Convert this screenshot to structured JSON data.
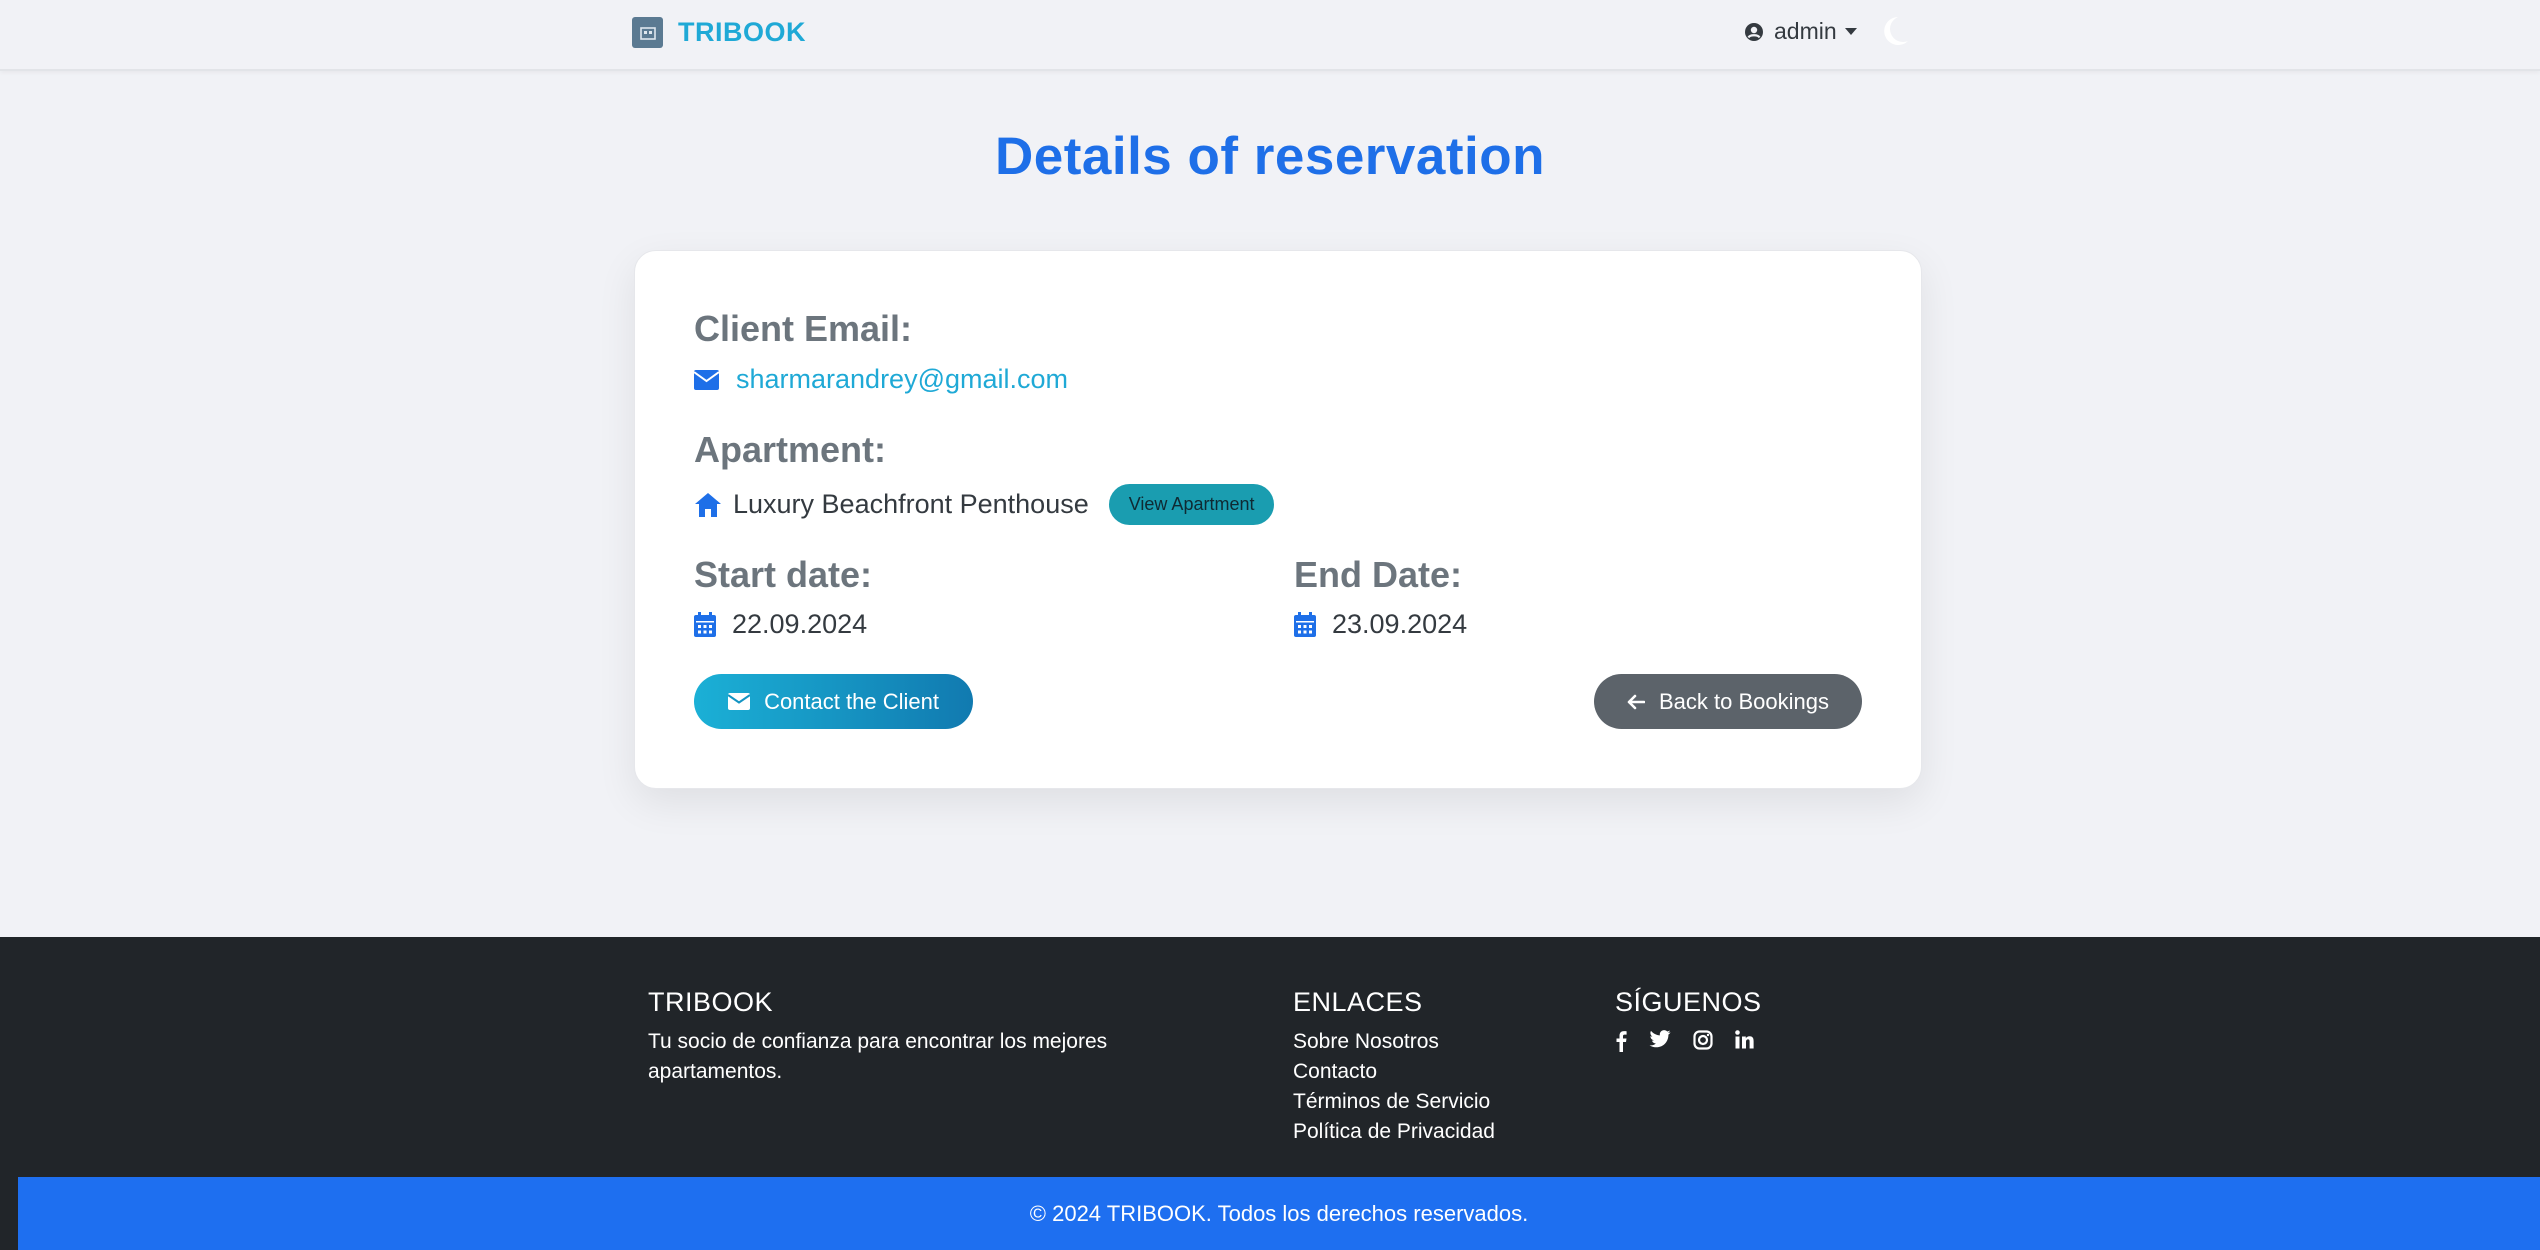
{
  "navbar": {
    "brand": "TRIBOOK",
    "user": "admin",
    "icons": {
      "logo": "hotel-logo-icon",
      "user": "user-circle-icon",
      "theme": "moon-icon"
    }
  },
  "page": {
    "title": "Details of reservation"
  },
  "reservation": {
    "client_email_label": "Client Email:",
    "client_email": "sharmarandrey@gmail.com",
    "apartment_label": "Apartment:",
    "apartment_name": "Luxury Beachfront Penthouse",
    "view_apartment_label": "View Apartment",
    "start_label": "Start date:",
    "start_date": "22.09.2024",
    "end_label": "End Date:",
    "end_date": "23.09.2024",
    "contact_label": "Contact the Client",
    "back_label": "Back to Bookings"
  },
  "footer": {
    "brand_heading": "TRIBOOK",
    "brand_desc": "Tu socio de confianza para encontrar los mejores apartamentos.",
    "links_heading": "ENLACES",
    "links": [
      "Sobre Nosotros",
      "Contacto",
      "Términos de Servicio",
      "Política de Privacidad"
    ],
    "follow_heading": "SÍGUENOS",
    "socials": [
      "facebook-icon",
      "twitter-icon",
      "instagram-icon",
      "linkedin-icon"
    ],
    "copyright": "© 2024 TRIBOOK. Todos los derechos reservados."
  },
  "colors": {
    "primary": "#1e6fe8",
    "brand": "#1fa9d6",
    "muted_label": "#6c757d",
    "footer_bg": "#212529",
    "copyright_bg": "#1e6ff0"
  }
}
